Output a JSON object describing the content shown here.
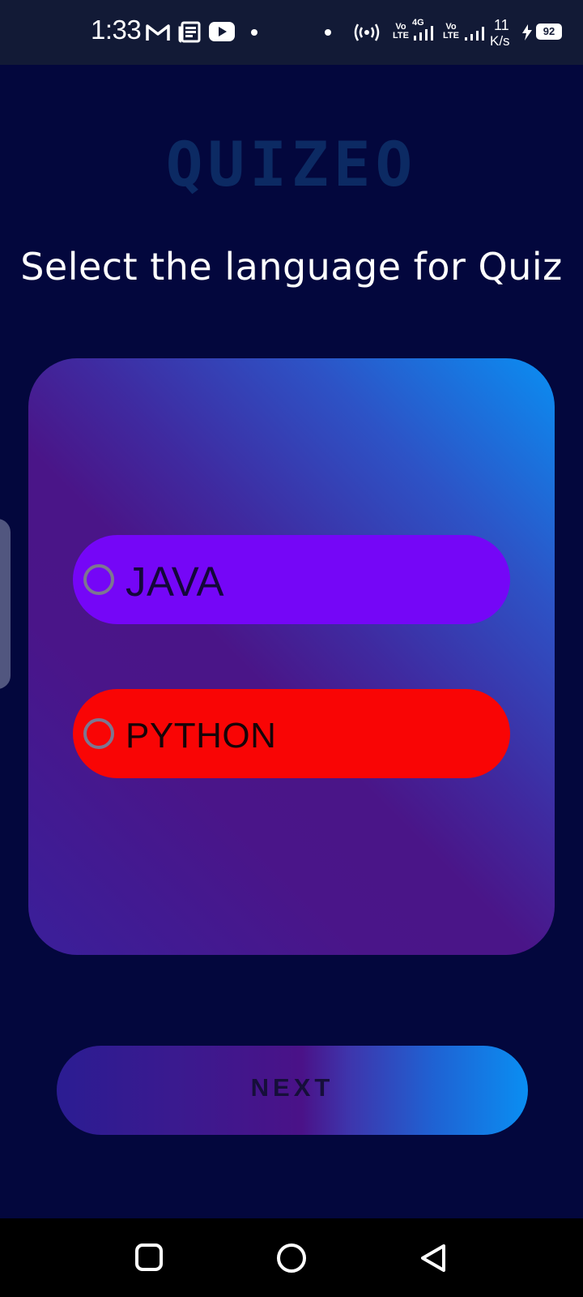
{
  "status_bar": {
    "time": "1:33",
    "net_speed_value": "11",
    "net_speed_unit": "K/s",
    "battery": "92",
    "signal1_label": "Vo LTE",
    "signal1_net": "4G",
    "signal2_label": "Vo LTE",
    "icons": [
      "gmail-icon",
      "news-icon",
      "youtube-icon",
      "hotspot-icon",
      "signal-icon",
      "charging-icon",
      "battery-icon"
    ]
  },
  "app": {
    "logo": "QUIZEO",
    "title": "Select the language for Quiz"
  },
  "options": [
    {
      "label": "JAVA",
      "color": "#7506f7",
      "selected": false
    },
    {
      "label": "PYTHON",
      "color": "#f90505",
      "selected": false
    }
  ],
  "next_button": {
    "label": "NEXT"
  },
  "colors": {
    "background": "#03073d",
    "status_bar": "#121a36",
    "card_gradient_start": "#0a8ef2",
    "card_gradient_end": "#4a1588",
    "logo": "#0c2a63"
  },
  "nav_bar": {
    "buttons": [
      "recents-button",
      "home-button",
      "back-button"
    ]
  }
}
